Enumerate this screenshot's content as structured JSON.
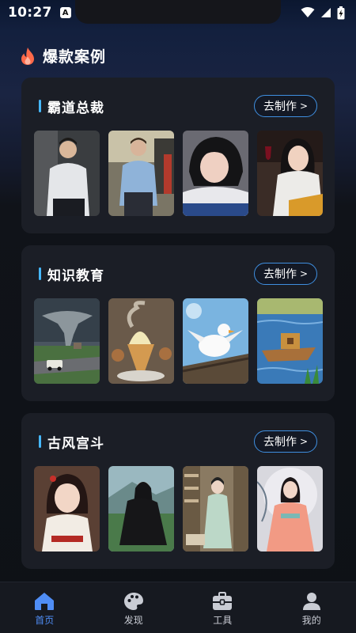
{
  "status": {
    "time": "10:27",
    "a_icon": "A"
  },
  "section": {
    "title": "爆款案例"
  },
  "cards": [
    {
      "title": "霸道总裁",
      "button": "去制作",
      "thumbs": [
        "man-white-shirt-image",
        "man-blue-shirt-street-image",
        "woman-lying-image",
        "woman-wine-image"
      ]
    },
    {
      "title": "知识教育",
      "button": "去制作",
      "thumbs": [
        "tornado-village-image",
        "ice-cream-cone-image",
        "white-duck-roof-image",
        "wooden-boat-lake-image"
      ]
    },
    {
      "title": "古风宫斗",
      "button": "去制作",
      "thumbs": [
        "ancient-girl-red-image",
        "ancient-man-black-robe-image",
        "ancient-library-image",
        "ancient-lady-pink-image"
      ]
    }
  ],
  "tabbar": [
    {
      "label": "首页",
      "icon": "home-icon",
      "active": true
    },
    {
      "label": "发现",
      "icon": "palette-icon",
      "active": false
    },
    {
      "label": "工具",
      "icon": "toolbox-icon",
      "active": false
    },
    {
      "label": "我的",
      "icon": "person-icon",
      "active": false
    }
  ],
  "colors": {
    "accent": "#4f8df5",
    "title_bar": "#46b8ff",
    "button_border": "#3f8fe0",
    "card_bg": "#1b1e26",
    "flame": "#ff6a4a"
  }
}
